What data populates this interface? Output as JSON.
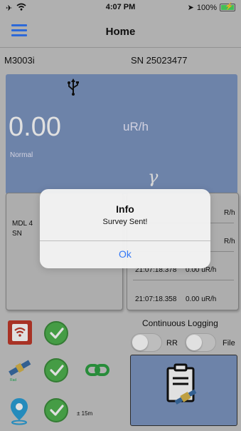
{
  "status_bar": {
    "time": "4:07 PM",
    "battery": "100%"
  },
  "nav": {
    "title": "Home"
  },
  "device": {
    "model": "M3003i",
    "serial": "SN 25023477"
  },
  "reading": {
    "value": "0.00",
    "unit": "uR/h",
    "status": "Normal",
    "radiation_symbol": "γ"
  },
  "left_card": {
    "line1": "MDL 4",
    "line2": "SN"
  },
  "log": [
    {
      "time": "",
      "value": "R/h"
    },
    {
      "time": "",
      "value": "R/h"
    },
    {
      "time": "21:07:18.378",
      "value": "0.00 uR/h"
    },
    {
      "time": "21:07:18.358",
      "value": "0.00 uR/h"
    }
  ],
  "alert": {
    "title": "Info",
    "message": "Survey Sent!",
    "button": "Ok"
  },
  "logging": {
    "label": "Continuous Logging",
    "toggle1": "RR",
    "toggle2": "File"
  },
  "gps": {
    "accuracy": "± 15m"
  },
  "colors": {
    "accent": "#3478f6",
    "panel": "#7d96c1",
    "check": "#4fb24f",
    "link": "#2ea043"
  }
}
